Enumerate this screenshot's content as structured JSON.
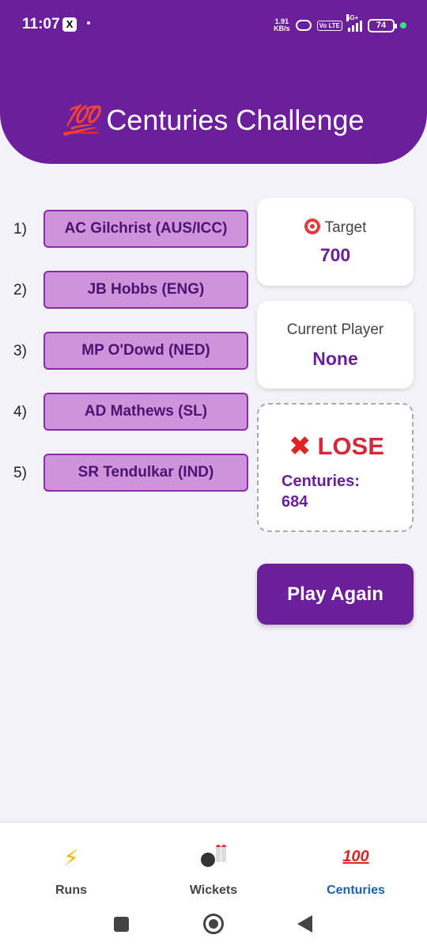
{
  "status_bar": {
    "time": "11:07",
    "x_badge": "X",
    "net_speed_value": "1.91",
    "net_speed_unit": "KB/s",
    "volte": "Vo LTE",
    "network": "5G+",
    "battery": "74"
  },
  "header": {
    "emoji": "💯",
    "title": "Centuries Challenge"
  },
  "players": [
    {
      "num": "1)",
      "name": "AC Gilchrist (AUS/ICC)"
    },
    {
      "num": "2)",
      "name": "JB Hobbs (ENG)"
    },
    {
      "num": "3)",
      "name": "MP O'Dowd (NED)"
    },
    {
      "num": "4)",
      "name": "AD Mathews (SL)"
    },
    {
      "num": "5)",
      "name": "SR Tendulkar (IND)"
    }
  ],
  "target": {
    "label": "Target",
    "value": "700"
  },
  "current_player": {
    "label": "Current Player",
    "value": "None"
  },
  "result": {
    "mark": "✖",
    "title": "LOSE",
    "label": "Centuries:",
    "value": "684"
  },
  "play_again": "Play Again",
  "bottom_nav": {
    "items": [
      {
        "label": "Runs",
        "icon": "lightning-icon"
      },
      {
        "label": "Wickets",
        "icon": "bowling-icon"
      },
      {
        "label": "Centuries",
        "icon": "hundred-icon"
      }
    ],
    "active": "Centuries"
  },
  "colors": {
    "primary": "#6b1f9b",
    "player_button": "#cf93dc",
    "lose": "#d62839",
    "active_nav": "#1f5fb0"
  }
}
